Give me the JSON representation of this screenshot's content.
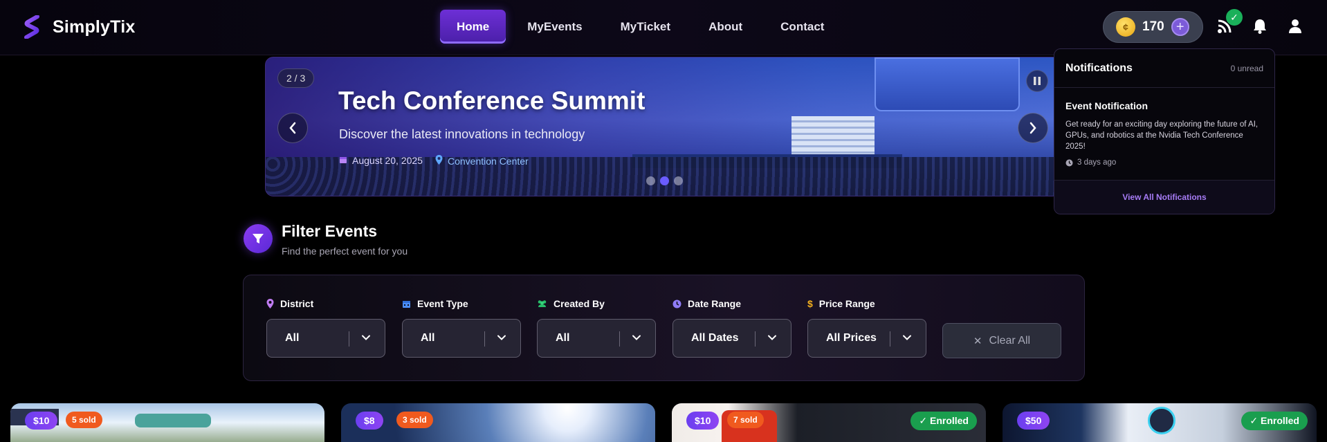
{
  "app": {
    "logo_text": "SimplyTix",
    "accent": "#6a2fd6"
  },
  "nav": {
    "items": [
      {
        "label": "Home",
        "active": true
      },
      {
        "label": "MyEvents",
        "active": false
      },
      {
        "label": "MyTicket",
        "active": false
      },
      {
        "label": "About",
        "active": false
      },
      {
        "label": "Contact",
        "active": false
      }
    ]
  },
  "header": {
    "coin_balance": "170",
    "coin_symbol": "¢",
    "add_symbol": "+",
    "check_symbol": "✓"
  },
  "hero": {
    "counter": "2 / 3",
    "title": "Tech Conference Summit",
    "subtitle": "Discover the latest innovations in technology",
    "date": "August 20, 2025",
    "location": "Convention Center",
    "slide_count": 3,
    "active_slide": 2
  },
  "notifications": {
    "title": "Notifications",
    "unread": "0 unread",
    "items": [
      {
        "title": "Event Notification",
        "body": "Get ready for an exciting day exploring the future of AI, GPUs, and robotics at the Nvidia Tech Conference 2025!",
        "time": "3 days ago"
      }
    ],
    "view_all": "View All Notifications"
  },
  "filters": {
    "title": "Filter Events",
    "subtitle": "Find the perfect event for you",
    "fields": [
      {
        "label": "District",
        "value": "All",
        "icon": "map-pin-icon",
        "color": "#c07cf2"
      },
      {
        "label": "Event Type",
        "value": "All",
        "icon": "calendar-icon",
        "color": "#4d8ef7"
      },
      {
        "label": "Created By",
        "value": "All",
        "icon": "users-icon",
        "color": "#27c06a"
      },
      {
        "label": "Date Range",
        "value": "All Dates",
        "icon": "clock-icon",
        "color": "#8f7cf6"
      },
      {
        "label": "Price Range",
        "value": "All Prices",
        "icon": "dollar-icon",
        "color": "#f2b01e"
      }
    ],
    "clear_label": "Clear All",
    "clear_symbol": "✕"
  },
  "events": [
    {
      "price": "$10",
      "sold": "5 sold",
      "enrolled": ""
    },
    {
      "price": "$8",
      "sold": "3 sold",
      "enrolled": ""
    },
    {
      "price": "$10",
      "sold": "7 sold",
      "enrolled": "✓ Enrolled"
    },
    {
      "price": "$50",
      "sold": "",
      "enrolled": "✓ Enrolled"
    }
  ]
}
